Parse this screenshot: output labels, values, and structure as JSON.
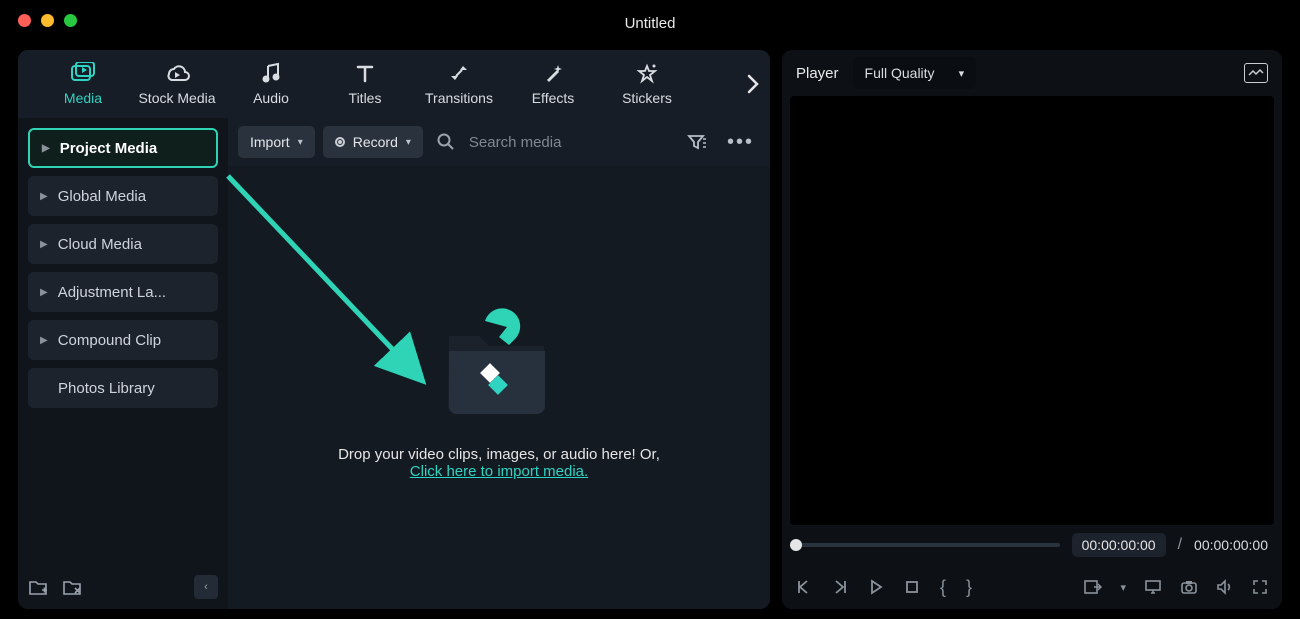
{
  "window": {
    "title": "Untitled"
  },
  "traffic": {
    "close": "#ff5f57",
    "min": "#febc2e",
    "max": "#28c840"
  },
  "tabs": [
    {
      "label": "Media",
      "active": true
    },
    {
      "label": "Stock Media",
      "active": false
    },
    {
      "label": "Audio",
      "active": false
    },
    {
      "label": "Titles",
      "active": false
    },
    {
      "label": "Transitions",
      "active": false
    },
    {
      "label": "Effects",
      "active": false
    },
    {
      "label": "Stickers",
      "active": false
    }
  ],
  "sidebar": {
    "items": [
      {
        "label": "Project Media",
        "active": true,
        "expandable": true
      },
      {
        "label": "Global Media",
        "active": false,
        "expandable": true
      },
      {
        "label": "Cloud Media",
        "active": false,
        "expandable": true
      },
      {
        "label": "Adjustment La...",
        "active": false,
        "expandable": true
      },
      {
        "label": "Compound Clip",
        "active": false,
        "expandable": true
      },
      {
        "label": "Photos Library",
        "active": false,
        "expandable": false
      }
    ]
  },
  "toolbar": {
    "import_label": "Import",
    "record_label": "Record",
    "search_placeholder": "Search media"
  },
  "drop": {
    "line1": "Drop your video clips, images, or audio here! Or,",
    "link": "Click here to import media."
  },
  "player": {
    "label": "Player",
    "quality": "Full Quality",
    "current": "00:00:00:00",
    "duration": "00:00:00:00",
    "separator": "/"
  },
  "annotation": {
    "arrow_color": "#2fd3b5"
  }
}
